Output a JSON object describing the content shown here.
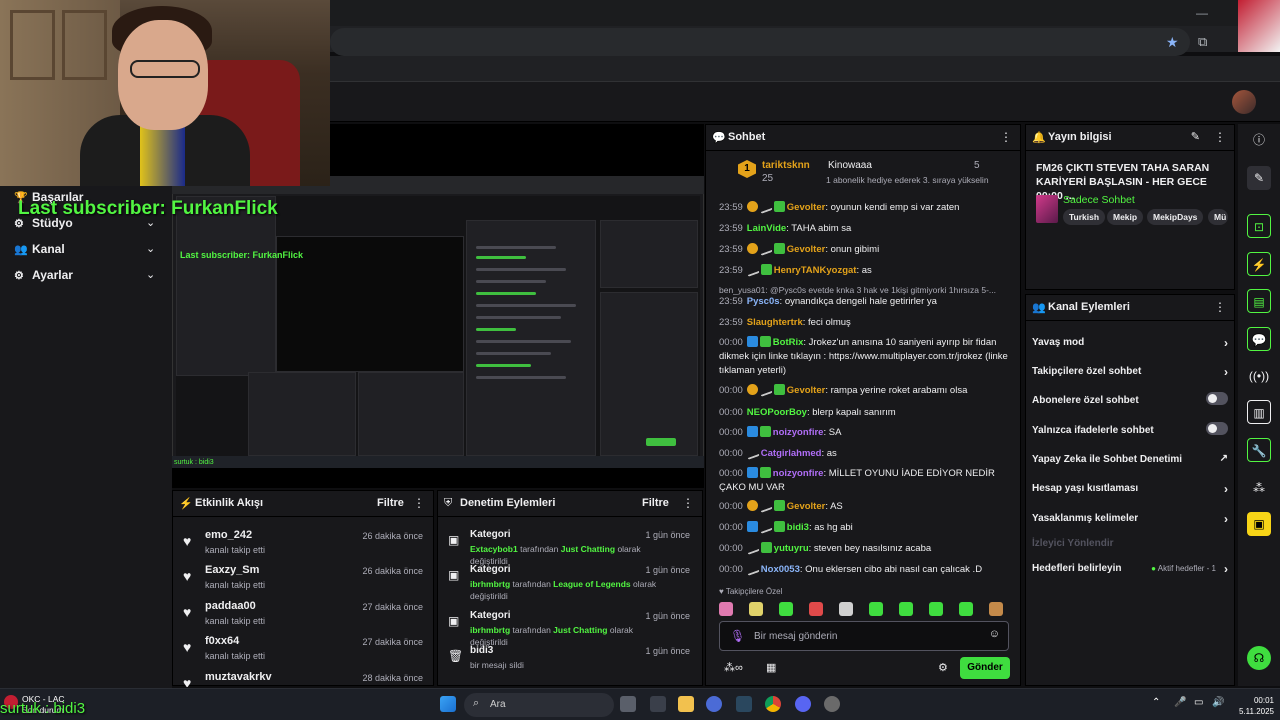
{
  "overlay": {
    "last_subscriber": "Last subscriber: FurkanFlick",
    "surtuk": "surtuk : bidi3"
  },
  "sidebar": {
    "items": [
      {
        "label": "Başarılar"
      },
      {
        "label": "Stüdyo"
      },
      {
        "label": "Kanal"
      },
      {
        "label": "Ayarlar"
      }
    ]
  },
  "activity_feed": {
    "title": "Etkinlik Akışı",
    "filter_label": "Filtre",
    "items": [
      {
        "name": "emo_242",
        "desc": "kanalı takip etti",
        "time": "26 dakika önce"
      },
      {
        "name": "Eaxzy_Sm",
        "desc": "kanalı takip etti",
        "time": "26 dakika önce"
      },
      {
        "name": "paddaa00",
        "desc": "kanalı takip etti",
        "time": "27 dakika önce"
      },
      {
        "name": "f0xx64",
        "desc": "kanalı takip etti",
        "time": "27 dakika önce"
      },
      {
        "name": "muztavakrkv",
        "desc": "",
        "time": "28 dakika önce"
      }
    ]
  },
  "mod_actions": {
    "title": "Denetim Eylemleri",
    "filter_label": "Filtre",
    "items": [
      {
        "title": "Kategori",
        "user": "Extacybob1",
        "mid": "tarafından",
        "target": "Just Chatting",
        "suffix": "olarak değiştirildi",
        "time": "1 gün önce"
      },
      {
        "title": "Kategori",
        "user": "ibrhmbrtg",
        "mid": "tarafından",
        "target": "League of Legends",
        "suffix": "olarak değiştirildi",
        "time": "1 gün önce"
      },
      {
        "title": "Kategori",
        "user": "ibrhmbrtg",
        "mid": "tarafından",
        "target": "Just Chatting",
        "suffix": "olarak değiştirildi",
        "time": "1 gün önce"
      },
      {
        "title": "bidi3",
        "desc": "bir mesajı sildi",
        "time": "1 gün önce"
      }
    ]
  },
  "chat": {
    "title": "Sohbet",
    "top_gifter": {
      "rank": "1",
      "name": "tariktsknn",
      "count": "25",
      "second_name": "Kinowaaa",
      "second_count": "5",
      "promo": "1 abonelik hediye ederek 3. sıraya yükselin"
    },
    "messages": [
      {
        "time": "23:59",
        "user": "Gevolter",
        "color": "#e3a21a",
        "text": ": oyunun kendi emp si var zaten",
        "badges": [
          "vip",
          "sword",
          "sub"
        ]
      },
      {
        "time": "23:59",
        "user": "LainVide",
        "color": "#52f542",
        "text": ": TAHA abim sa",
        "badges": []
      },
      {
        "time": "23:59",
        "user": "Gevolter",
        "color": "#e3a21a",
        "text": ": onun gibimi",
        "badges": [
          "vip",
          "sword",
          "sub"
        ]
      },
      {
        "time": "23:59",
        "user": "HenryTANKyozgat",
        "color": "#e3a21a",
        "text": ": as",
        "badges": [
          "sword",
          "sub"
        ]
      },
      {
        "time": "",
        "user": "",
        "color": "#adadb8",
        "text": "ben_yusa01: @Pysc0s evetde knka 3 hak ve 1kişi gitmiyorki 1hırsıza 5-...",
        "badges": []
      },
      {
        "time": "23:59",
        "user": "Pysc0s",
        "color": "#8ab4f8",
        "text": ": oynandıkça dengeli hale getirirler ya",
        "badges": []
      },
      {
        "time": "23:59",
        "user": "Slaughtertrk",
        "color": "#e3a21a",
        "text": ": feci olmuş",
        "badges": []
      },
      {
        "time": "00:00",
        "user": "BotRix",
        "color": "#52f542",
        "text": ": Jrokez'un anısına 10 saniyeni ayırıp bir fidan dikmek için linke tıklayın : https://www.multiplayer.com.tr/jrokez (linke tıklaman yeterli)",
        "badges": [
          "mod",
          "sub"
        ]
      },
      {
        "time": "00:00",
        "user": "Gevolter",
        "color": "#e3a21a",
        "text": ": rampa yerine roket arabamı olsa",
        "badges": [
          "vip",
          "sword",
          "sub"
        ]
      },
      {
        "time": "00:00",
        "user": "NEOPoorBoy",
        "color": "#52f542",
        "text": ": blerp kapalı sanırım",
        "badges": []
      },
      {
        "time": "00:00",
        "user": "noizyonfire",
        "color": "#b06ef7",
        "text": ": SA",
        "badges": [
          "mod",
          "sub"
        ]
      },
      {
        "time": "00:00",
        "user": "Catgirlahmed",
        "color": "#b06ef7",
        "text": ": as",
        "badges": [
          "sword"
        ]
      },
      {
        "time": "00:00",
        "user": "noizyonfire",
        "color": "#b06ef7",
        "text": ": MİLLET OYUNU İADE EDİYOR NEDİR ÇAKO MU VAR",
        "badges": [
          "mod",
          "sub"
        ]
      },
      {
        "time": "00:00",
        "user": "Gevolter",
        "color": "#e3a21a",
        "text": ": AS",
        "badges": [
          "vip",
          "sword",
          "sub"
        ]
      },
      {
        "time": "00:00",
        "user": "bidi3",
        "color": "#52f542",
        "text": ": as hg abi",
        "badges": [
          "mod",
          "sword",
          "sub"
        ]
      },
      {
        "time": "00:00",
        "user": "yutuyru",
        "color": "#52f542",
        "text": ": steven bey nasılsınız acaba",
        "badges": [
          "sword",
          "sub"
        ]
      },
      {
        "time": "00:00",
        "user": "Nox0053",
        "color": "#8ab4f8",
        "text": ": Onu eklersen cibo abi nasıl can çalıcak .D",
        "badges": [
          "sword"
        ]
      }
    ],
    "followers_only_label": "Takipçilere Özel",
    "input_placeholder": "Bir mesaj gönderin",
    "send_label": "Gönder"
  },
  "stream_info": {
    "title": "Yayın bilgisi",
    "stream_title": "FM26 ÇIKTI STEVEN TAHA SARAN KARİYERİ BAŞLASIN - HER GECE 00:00 ...",
    "category": "Sadece Sohbet",
    "tags": [
      "Turkish",
      "Mekip",
      "MekipDays",
      "Mü"
    ]
  },
  "channel_actions": {
    "title": "Kanal Eylemleri",
    "rows": [
      {
        "label": "Yavaş mod",
        "kind": "chevron"
      },
      {
        "label": "Takipçilere özel sohbet",
        "kind": "chevron"
      },
      {
        "label": "Abonelere özel sohbet",
        "kind": "toggle"
      },
      {
        "label": "Yalnızca ifadelerle sohbet",
        "kind": "toggle"
      },
      {
        "label": "Yapay Zeka ile Sohbet Denetimi",
        "kind": "external"
      },
      {
        "label": "Hesap yaşı kısıtlaması",
        "kind": "chevron"
      },
      {
        "label": "Yasaklanmış kelimeler",
        "kind": "chevron"
      },
      {
        "label": "İzleyici Yönlendir",
        "kind": "disabled"
      },
      {
        "label": "Hedefleri belirleyin",
        "kind": "status"
      }
    ],
    "goals_status": "Aktif hedefler - 1"
  },
  "taskbar": {
    "search_placeholder": "Ara",
    "weather_title": "OKC - LAC",
    "weather_sub": "Son durum",
    "time": "00:01",
    "date": "5.11.2025"
  },
  "colors": {
    "accent_green": "#52f542",
    "panel_bg": "#18181b",
    "page_bg": "#0e0e10"
  }
}
